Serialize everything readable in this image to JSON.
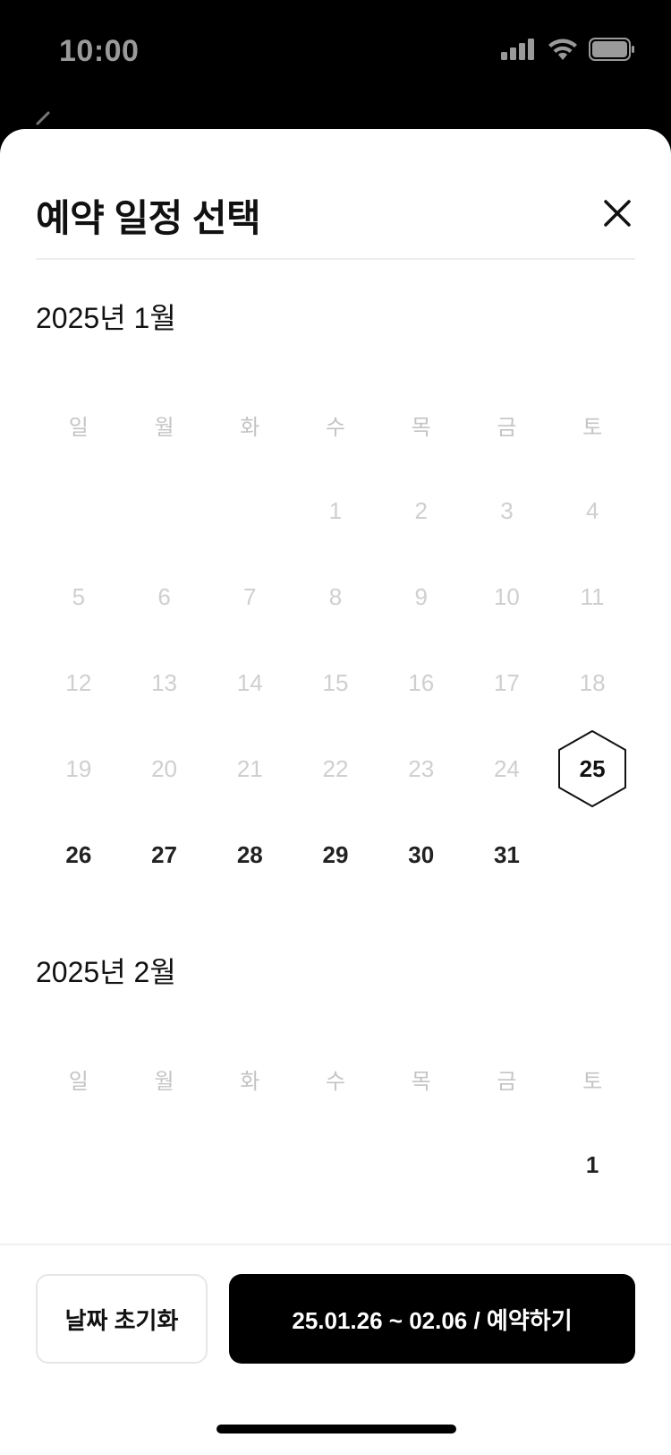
{
  "status": {
    "time": "10:00"
  },
  "sheet": {
    "title": "예약 일정 선택"
  },
  "weekdays": [
    "일",
    "월",
    "화",
    "수",
    "목",
    "금",
    "토"
  ],
  "months": [
    {
      "title": "2025년 1월",
      "weeks": [
        [
          null,
          null,
          null,
          "1",
          "2",
          "3",
          "4"
        ],
        [
          "5",
          "6",
          "7",
          "8",
          "9",
          "10",
          "11"
        ],
        [
          "12",
          "13",
          "14",
          "15",
          "16",
          "17",
          "18"
        ],
        [
          "19",
          "20",
          "21",
          "22",
          "23",
          "24",
          "25"
        ],
        [
          "26",
          "27",
          "28",
          "29",
          "30",
          "31",
          null
        ]
      ]
    },
    {
      "title": "2025년 2월",
      "weeks": [
        [
          null,
          null,
          null,
          null,
          null,
          null,
          "1"
        ]
      ]
    }
  ],
  "selected_day": "25",
  "footer": {
    "reset_label": "날짜 초기화",
    "reserve_label": "25.01.26 ~ 02.06 / 예약하기"
  }
}
